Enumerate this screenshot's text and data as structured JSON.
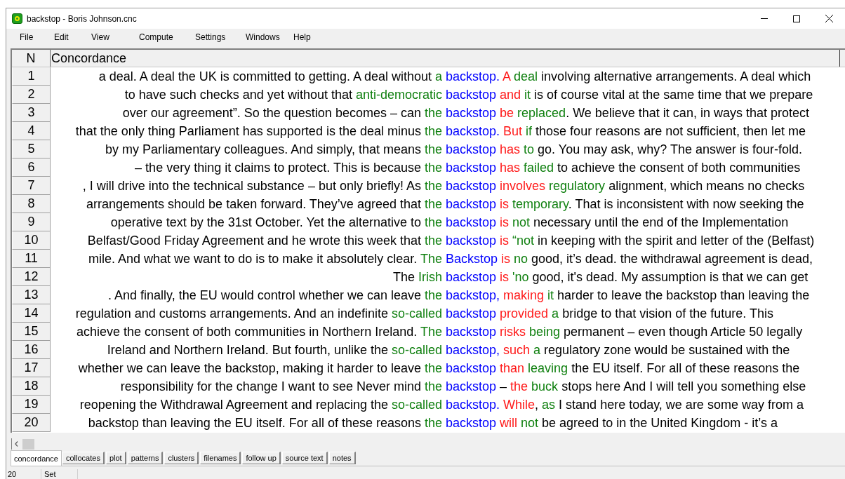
{
  "window": {
    "title": "backstop - Boris Johnson.cnc"
  },
  "menu": [
    "File",
    "Edit",
    "View",
    "Compute",
    "Settings",
    "Windows",
    "Help"
  ],
  "columns": [
    "N",
    "Concordance"
  ],
  "rows": [
    {
      "n": "1",
      "segments": [
        {
          "kind": "plain",
          "text": "a deal. A deal the UK is committed to getting. A deal without "
        },
        {
          "kind": "l1",
          "text": "a"
        },
        {
          "kind": "node",
          "text": " backstop. "
        },
        {
          "kind": "r1",
          "text": "A "
        },
        {
          "kind": "r2",
          "text": "deal"
        },
        {
          "kind": "plain",
          "text": " involving alternative arrangements. A deal which"
        }
      ]
    },
    {
      "n": "2",
      "segments": [
        {
          "kind": "plain",
          "text": "to have such checks and yet without that "
        },
        {
          "kind": "l1",
          "text": "anti-democratic"
        },
        {
          "kind": "node",
          "text": " backstop "
        },
        {
          "kind": "r1",
          "text": "and "
        },
        {
          "kind": "r2",
          "text": "it"
        },
        {
          "kind": "plain",
          "text": " is of course vital at the same time that we prepare"
        }
      ]
    },
    {
      "n": "3",
      "segments": [
        {
          "kind": "plain",
          "text": "over our agreement”. So the question becomes – can "
        },
        {
          "kind": "l1",
          "text": "the"
        },
        {
          "kind": "node",
          "text": " backstop "
        },
        {
          "kind": "r1",
          "text": "be "
        },
        {
          "kind": "r2",
          "text": "replaced"
        },
        {
          "kind": "plain",
          "text": ". We believe that it can, in ways that protect"
        }
      ]
    },
    {
      "n": "4",
      "segments": [
        {
          "kind": "plain",
          "text": "that the only thing Parliament has supported is the deal minus "
        },
        {
          "kind": "l1",
          "text": "the"
        },
        {
          "kind": "node",
          "text": " backstop. "
        },
        {
          "kind": "r1",
          "text": "But "
        },
        {
          "kind": "r2",
          "text": "if"
        },
        {
          "kind": "plain",
          "text": " those four reasons are not sufficient, then let me"
        }
      ]
    },
    {
      "n": "5",
      "segments": [
        {
          "kind": "plain",
          "text": "by my Parliamentary colleagues. And simply, that means "
        },
        {
          "kind": "l1",
          "text": "the"
        },
        {
          "kind": "node",
          "text": " backstop "
        },
        {
          "kind": "r1",
          "text": "has "
        },
        {
          "kind": "r2",
          "text": "to"
        },
        {
          "kind": "plain",
          "text": " go. You may ask, why? The answer is four-fold."
        }
      ]
    },
    {
      "n": "6",
      "segments": [
        {
          "kind": "plain",
          "text": "– the very thing it claims to protect. This is because "
        },
        {
          "kind": "l1",
          "text": "the"
        },
        {
          "kind": "node",
          "text": " backstop "
        },
        {
          "kind": "r1",
          "text": "has "
        },
        {
          "kind": "r2",
          "text": "failed"
        },
        {
          "kind": "plain",
          "text": " to achieve the consent of both communities"
        }
      ]
    },
    {
      "n": "7",
      "segments": [
        {
          "kind": "plain",
          "text": ", I will drive into the technical substance – but only briefly! As "
        },
        {
          "kind": "l1",
          "text": "the"
        },
        {
          "kind": "node",
          "text": " backstop "
        },
        {
          "kind": "r1",
          "text": "involves "
        },
        {
          "kind": "r2",
          "text": "regulatory"
        },
        {
          "kind": "plain",
          "text": " alignment, which means no checks"
        }
      ]
    },
    {
      "n": "8",
      "segments": [
        {
          "kind": "plain",
          "text": "arrangements should be taken forward. They’ve agreed that "
        },
        {
          "kind": "l1",
          "text": "the"
        },
        {
          "kind": "node",
          "text": " backstop "
        },
        {
          "kind": "r1",
          "text": "is "
        },
        {
          "kind": "r2",
          "text": "temporary"
        },
        {
          "kind": "plain",
          "text": ". That is inconsistent with now seeking the"
        }
      ]
    },
    {
      "n": "9",
      "segments": [
        {
          "kind": "plain",
          "text": "operative text by the 31st October. Yet the alternative to "
        },
        {
          "kind": "l1",
          "text": "the"
        },
        {
          "kind": "node",
          "text": " backstop "
        },
        {
          "kind": "r1",
          "text": "is "
        },
        {
          "kind": "r2",
          "text": "not"
        },
        {
          "kind": "plain",
          "text": " necessary until the end of the Implementation"
        }
      ]
    },
    {
      "n": "10",
      "segments": [
        {
          "kind": "plain",
          "text": "Belfast/Good Friday Agreement and he wrote this week that "
        },
        {
          "kind": "l1",
          "text": "the"
        },
        {
          "kind": "node",
          "text": " backstop "
        },
        {
          "kind": "r1",
          "text": "is "
        },
        {
          "kind": "r2",
          "text": "“not"
        },
        {
          "kind": "plain",
          "text": " in keeping with the spirit and letter of the (Belfast)"
        }
      ]
    },
    {
      "n": "11",
      "segments": [
        {
          "kind": "plain",
          "text": "mile. And what we want to do is to make it absolutely clear. "
        },
        {
          "kind": "l1",
          "text": "The"
        },
        {
          "kind": "node",
          "text": " Backstop "
        },
        {
          "kind": "r1",
          "text": "is "
        },
        {
          "kind": "r2",
          "text": "no"
        },
        {
          "kind": "plain",
          "text": " good, it’s dead. the withdrawal agreement is dead,"
        }
      ]
    },
    {
      "n": "12",
      "segments": [
        {
          "kind": "plain",
          "text": "The "
        },
        {
          "kind": "l1",
          "text": "Irish"
        },
        {
          "kind": "node",
          "text": " backstop "
        },
        {
          "kind": "r1",
          "text": "is "
        },
        {
          "kind": "r2",
          "text": "'no"
        },
        {
          "kind": "plain",
          "text": " good, it's dead. My assumption is that we can get"
        }
      ]
    },
    {
      "n": "13",
      "segments": [
        {
          "kind": "plain",
          "text": ". And finally, the EU would control whether we can leave "
        },
        {
          "kind": "l1",
          "text": "the"
        },
        {
          "kind": "node",
          "text": " backstop, "
        },
        {
          "kind": "r1",
          "text": "making "
        },
        {
          "kind": "r2",
          "text": "it"
        },
        {
          "kind": "plain",
          "text": " harder to leave the backstop than leaving the"
        }
      ]
    },
    {
      "n": "14",
      "segments": [
        {
          "kind": "plain",
          "text": "regulation and customs arrangements. And an indefinite "
        },
        {
          "kind": "l1",
          "text": "so-called"
        },
        {
          "kind": "node",
          "text": " backstop "
        },
        {
          "kind": "r1",
          "text": "provided "
        },
        {
          "kind": "r2",
          "text": "a"
        },
        {
          "kind": "plain",
          "text": " bridge to that vision of the future. This"
        }
      ]
    },
    {
      "n": "15",
      "segments": [
        {
          "kind": "plain",
          "text": "achieve the consent of both communities in Northern Ireland. "
        },
        {
          "kind": "l1",
          "text": "The"
        },
        {
          "kind": "node",
          "text": " backstop "
        },
        {
          "kind": "r1",
          "text": "risks "
        },
        {
          "kind": "r2",
          "text": "being"
        },
        {
          "kind": "plain",
          "text": " permanent – even though Article 50 legally"
        }
      ]
    },
    {
      "n": "16",
      "segments": [
        {
          "kind": "plain",
          "text": "Ireland and Northern Ireland. But fourth, unlike the "
        },
        {
          "kind": "l1",
          "text": "so-called"
        },
        {
          "kind": "node",
          "text": " backstop, "
        },
        {
          "kind": "r1",
          "text": "such "
        },
        {
          "kind": "r2",
          "text": "a"
        },
        {
          "kind": "plain",
          "text": " regulatory zone would be sustained with the"
        }
      ]
    },
    {
      "n": "17",
      "segments": [
        {
          "kind": "plain",
          "text": "whether we can leave the backstop, making it harder to leave "
        },
        {
          "kind": "l1",
          "text": "the"
        },
        {
          "kind": "node",
          "text": " backstop "
        },
        {
          "kind": "r1",
          "text": "than "
        },
        {
          "kind": "r2",
          "text": "leaving"
        },
        {
          "kind": "plain",
          "text": " the EU itself. For all of these reasons the"
        }
      ]
    },
    {
      "n": "18",
      "segments": [
        {
          "kind": "plain",
          "text": "responsibility for the change I want to see Never mind "
        },
        {
          "kind": "l1",
          "text": "the"
        },
        {
          "kind": "node",
          "text": " backstop "
        },
        {
          "kind": "plain",
          "text": "– "
        },
        {
          "kind": "r1",
          "text": "the "
        },
        {
          "kind": "r2",
          "text": "buck"
        },
        {
          "kind": "plain",
          "text": " stops here And I will tell you something else"
        }
      ]
    },
    {
      "n": "19",
      "segments": [
        {
          "kind": "plain",
          "text": "reopening the Withdrawal Agreement and replacing the "
        },
        {
          "kind": "l1",
          "text": "so-called"
        },
        {
          "kind": "node",
          "text": " backstop. "
        },
        {
          "kind": "r1",
          "text": "While"
        },
        {
          "kind": "plain",
          "text": ", "
        },
        {
          "kind": "r2",
          "text": "as"
        },
        {
          "kind": "plain",
          "text": " I stand here today, we are some way from a"
        }
      ]
    },
    {
      "n": "20",
      "segments": [
        {
          "kind": "plain",
          "text": "backstop than leaving the EU itself. For all of these reasons "
        },
        {
          "kind": "l1",
          "text": "the"
        },
        {
          "kind": "node",
          "text": " backstop "
        },
        {
          "kind": "r1",
          "text": "will "
        },
        {
          "kind": "r2",
          "text": "not"
        },
        {
          "kind": "plain",
          "text": " be agreed to in the United Kingdom - it’s a"
        }
      ]
    }
  ],
  "tabs": [
    {
      "label": "concordance",
      "selected": true
    },
    {
      "label": "collocates",
      "selected": false
    },
    {
      "label": "plot",
      "selected": false
    },
    {
      "label": "patterns",
      "selected": false
    },
    {
      "label": "clusters",
      "selected": false
    },
    {
      "label": "filenames",
      "selected": false
    },
    {
      "label": "follow up",
      "selected": false
    },
    {
      "label": "source text",
      "selected": false
    },
    {
      "label": "notes",
      "selected": false
    }
  ],
  "status_bar": [
    "20",
    "Set"
  ]
}
